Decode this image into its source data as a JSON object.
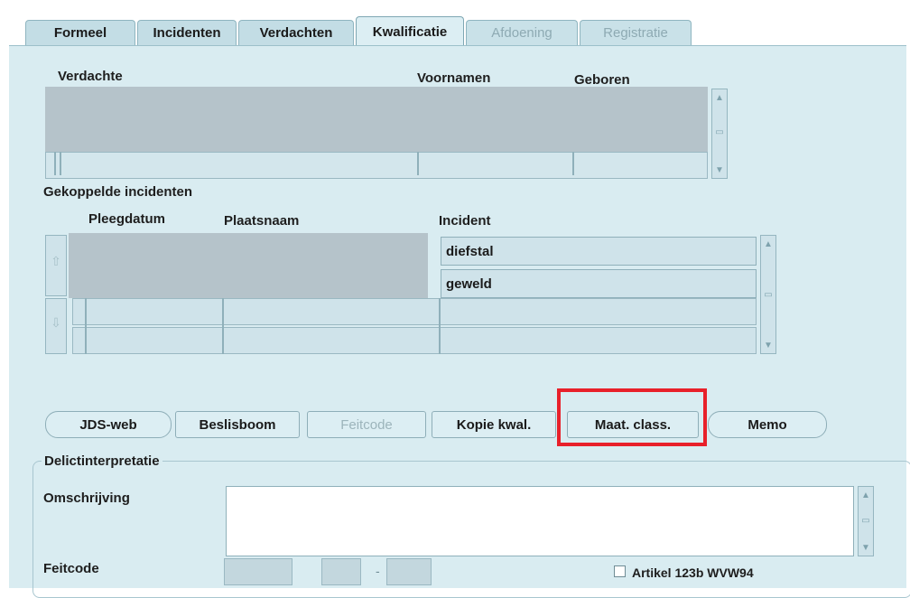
{
  "tabs": [
    {
      "label": "Formeel"
    },
    {
      "label": "Incidenten"
    },
    {
      "label": "Verdachten"
    },
    {
      "label": "Kwalificatie"
    },
    {
      "label": "Afdoening"
    },
    {
      "label": "Registratie"
    }
  ],
  "suspects": {
    "columns": [
      "Verdachte",
      "Voornamen",
      "Geboren"
    ]
  },
  "linked_incidents": {
    "title": "Gekoppelde incidenten",
    "columns": [
      "Pleegdatum",
      "Plaatsnaam",
      "Incident"
    ],
    "rows": [
      {
        "incident": "diefstal"
      },
      {
        "incident": "geweld"
      },
      {
        "incident": ""
      },
      {
        "incident": ""
      }
    ]
  },
  "buttons": {
    "jds_web": "JDS-web",
    "beslisboom": "Beslisboom",
    "feitcode": "Feitcode",
    "kopie_kwal": "Kopie kwal.",
    "maat_class": "Maat. class.",
    "memo": "Memo"
  },
  "delict": {
    "group_title": "Delictinterpretatie",
    "omschrijving_label": "Omschrijving",
    "omschrijving_value": "",
    "feitcode_label": "Feitcode",
    "checkbox_label": "Artikel 123b WVW94",
    "checkbox_checked": false
  },
  "colors": {
    "highlight": "#e8202a"
  }
}
